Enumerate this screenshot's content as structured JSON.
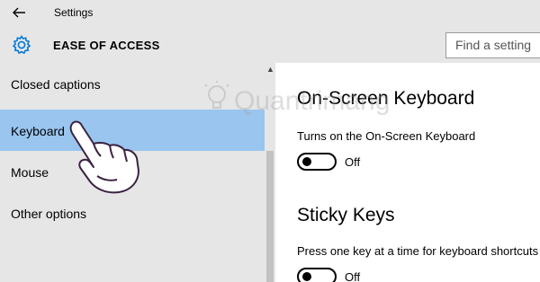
{
  "titlebar": {
    "back_icon": "back-arrow-icon",
    "title": "Settings"
  },
  "header": {
    "icon": "gear-icon",
    "section_title": "EASE OF ACCESS",
    "search": {
      "placeholder": "Find a setting",
      "value": ""
    }
  },
  "sidebar": {
    "items": [
      {
        "label": "Closed captions",
        "selected": false
      },
      {
        "label": "Keyboard",
        "selected": true
      },
      {
        "label": "Mouse",
        "selected": false
      },
      {
        "label": "Other options",
        "selected": false
      }
    ]
  },
  "main": {
    "settings": [
      {
        "heading": "On-Screen Keyboard",
        "description": "Turns on the On-Screen Keyboard",
        "state": "Off"
      },
      {
        "heading": "Sticky Keys",
        "description": "Press one key at a time for keyboard shortcuts",
        "state": "Off"
      }
    ]
  },
  "watermark": {
    "text": "Quantrimang"
  },
  "colors": {
    "chrome": "#e6e6e6",
    "selected": "#99c5ef",
    "accent": "#0078d7"
  }
}
